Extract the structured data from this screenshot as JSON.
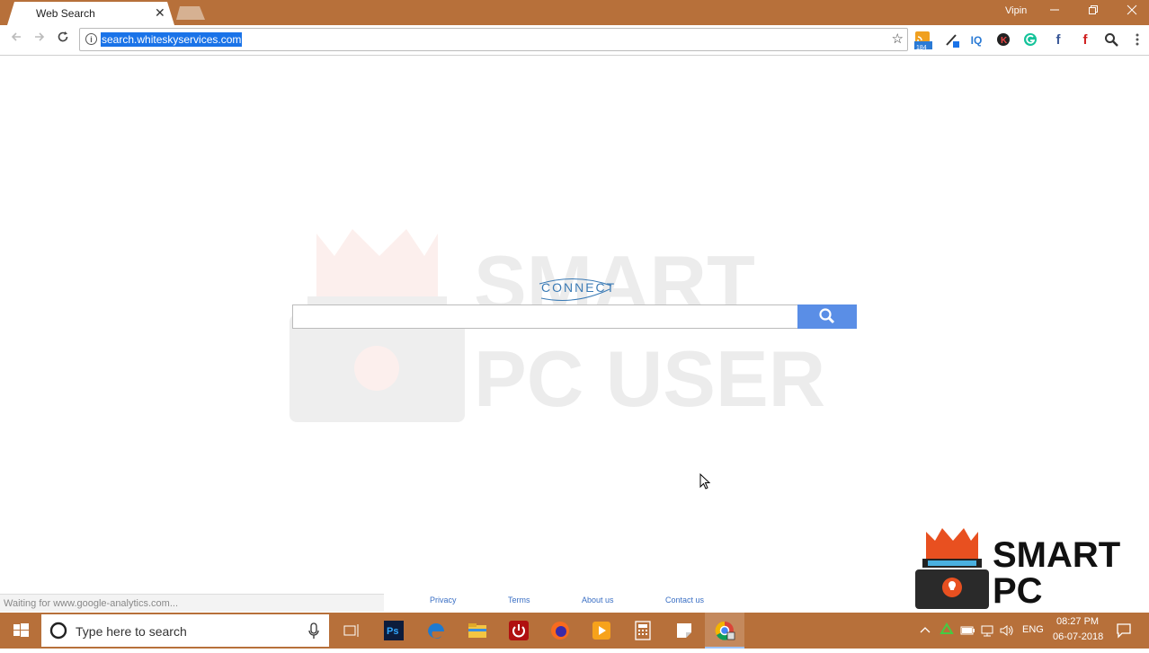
{
  "browser": {
    "tab_title": "Web Search",
    "tab_close": "✕",
    "user": "Vipin",
    "url": "search.whiteskyservices.com",
    "rss_badge": "184"
  },
  "page": {
    "logo_text": "CONNECT",
    "watermark": {
      "line1": "SMART",
      "line2": "PC USER"
    },
    "status_text": "Waiting for www.google-analytics.com...",
    "footer": [
      "Privacy",
      "Terms",
      "About us",
      "Contact us"
    ]
  },
  "brand": {
    "line1": "SMART",
    "line2": "PC USER"
  },
  "taskbar": {
    "search_placeholder": "Type here to search",
    "lang": "ENG",
    "time": "08:27 PM",
    "date": "06-07-2018"
  },
  "colors": {
    "chrome_frame": "#b7703a",
    "search_button": "#5a8ee6",
    "url_highlight": "#1a73e8"
  }
}
